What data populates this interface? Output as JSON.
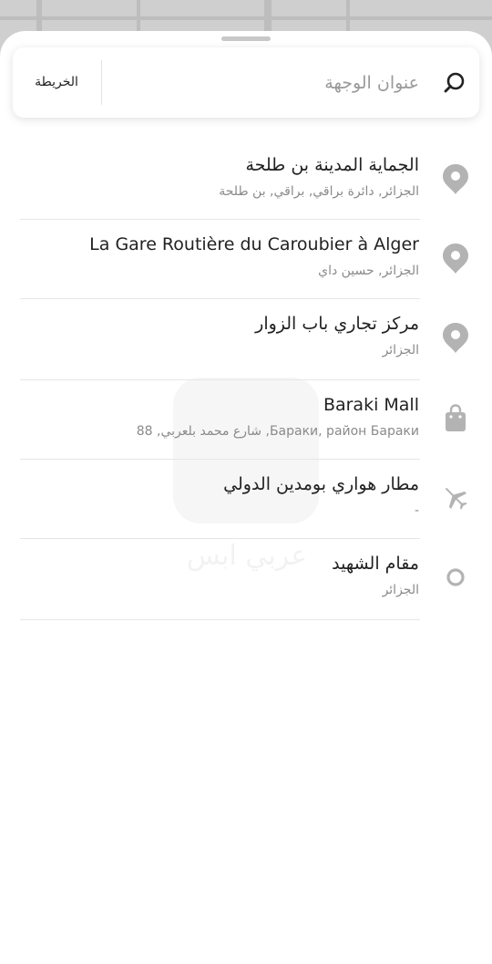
{
  "search": {
    "placeholder": "عنوان الوجهة",
    "map_button_label": "الخريطة"
  },
  "suggestions": [
    {
      "title": "الجماية المدينة بن طلحة",
      "subtitle": "الجزائر, دائرة براقي, براقي, بن طلحة",
      "icon": "location-pin-icon"
    },
    {
      "title": "La Gare Routière du Caroubier à Alger",
      "subtitle": "الجزائر, حسين داي",
      "icon": "location-pin-icon"
    },
    {
      "title": "مركز تجاري باب الزوار",
      "subtitle": "الجزائر",
      "icon": "location-pin-icon"
    },
    {
      "title": "Baraki Mall",
      "subtitle": "88 ,شارع محمد بلعربي ,Бараки, район Бараки",
      "icon": "shopping-bag-icon"
    },
    {
      "title": "مطار هواري بومدين الدولي",
      "subtitle": "-",
      "icon": "airplane-icon"
    },
    {
      "title": "مقام الشهيد",
      "subtitle": "الجزائر",
      "icon": "landmark-circle-icon"
    }
  ],
  "watermark": {
    "text": "عربي ابس"
  },
  "colors": {
    "icon": "#b3b3b3",
    "title": "#222222",
    "subtitle": "#8a8a8a"
  }
}
